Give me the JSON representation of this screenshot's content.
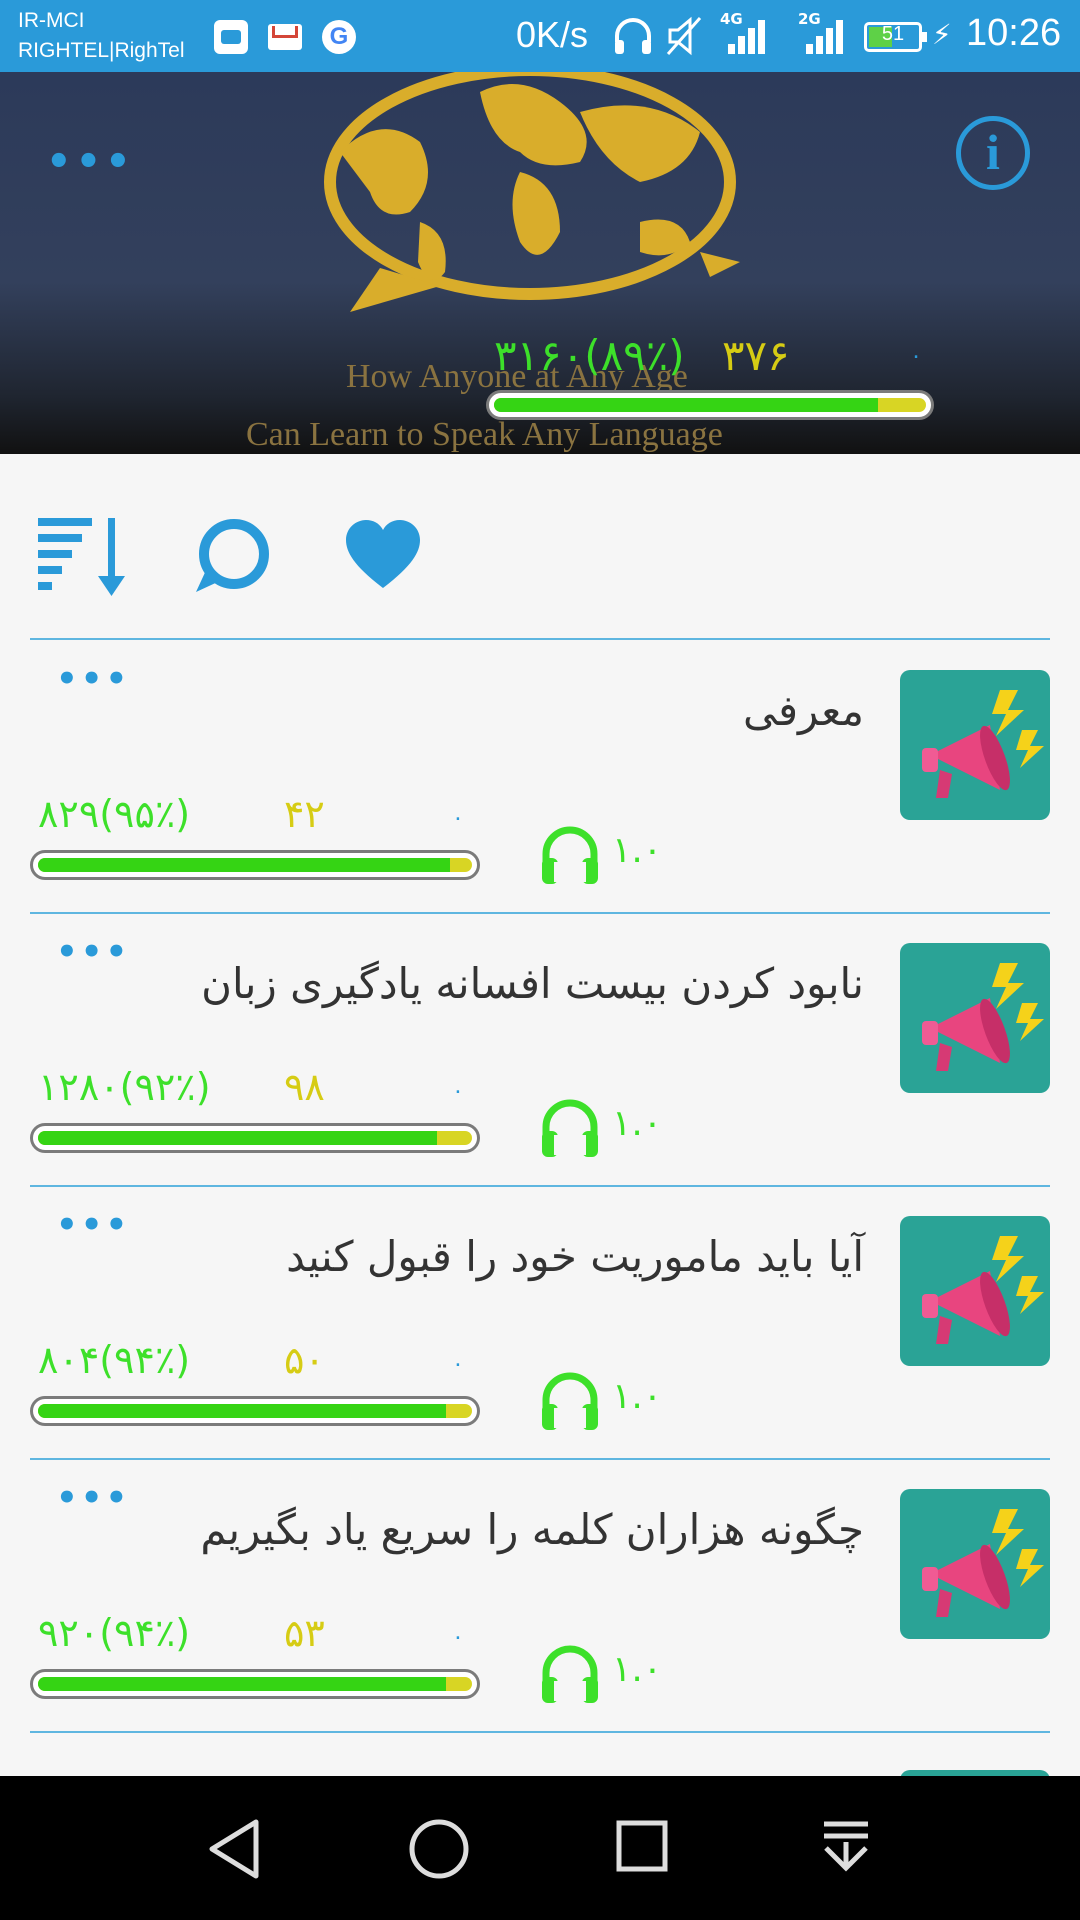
{
  "status_bar": {
    "carrier_line1": "IR-MCI",
    "carrier_line2": "RIGHTEL|RighTel",
    "net_speed": "0K/s",
    "signal1_tag": "4G",
    "signal2_tag": "2G",
    "battery_level": "51",
    "battery_fill_fraction": 0.51,
    "time": "10:26"
  },
  "header": {
    "cover_text_line1": "How Anyone at Any Age",
    "cover_text_line2": "Can Learn to Speak Any Language",
    "more_label": "•••",
    "info_label": "i",
    "total": "۳۱۶۰(۸۹٪)",
    "count": "۳۷۶",
    "zero": "۰",
    "progress_fraction": 0.89
  },
  "toolbar": {
    "sort_icon": "sort-descending-icon",
    "comment_icon": "comment-icon",
    "favorite_icon": "heart-icon"
  },
  "items": [
    {
      "title": "معرفی",
      "more": "•••",
      "total": "۸۲۹(۹۵٪)",
      "count": "۴۲",
      "zero": "۰",
      "speed": "۱.۰",
      "progress_fraction": 0.95
    },
    {
      "title": "نابود کردن بیست افسانه یادگیری زبان",
      "more": "•••",
      "total": "۱۲۸۰(۹۲٪)",
      "count": "۹۸",
      "zero": "۰",
      "speed": "۱.۰",
      "progress_fraction": 0.92
    },
    {
      "title": "آیا باید ماموریت خود را قبول کنید",
      "more": "•••",
      "total": "۸۰۴(۹۴٪)",
      "count": "۵۰",
      "zero": "۰",
      "speed": "۱.۰",
      "progress_fraction": 0.94
    },
    {
      "title": "چگونه هزاران کلمه را سریع یاد بگیریم",
      "more": "•••",
      "total": "۹۲۰(۹۴٪)",
      "count": "۵۳",
      "zero": "۰",
      "speed": "۱.۰",
      "progress_fraction": 0.94
    }
  ],
  "navbar": {
    "back_icon": "back-triangle-icon",
    "home_icon": "home-circle-icon",
    "recents_icon": "recents-square-icon",
    "notifications_icon": "pull-down-icon"
  },
  "colors": {
    "accent": "#2a9ad9",
    "progress_green": "#35d414",
    "progress_yellow": "#d8d524",
    "thumb_bg": "#2aa396"
  }
}
